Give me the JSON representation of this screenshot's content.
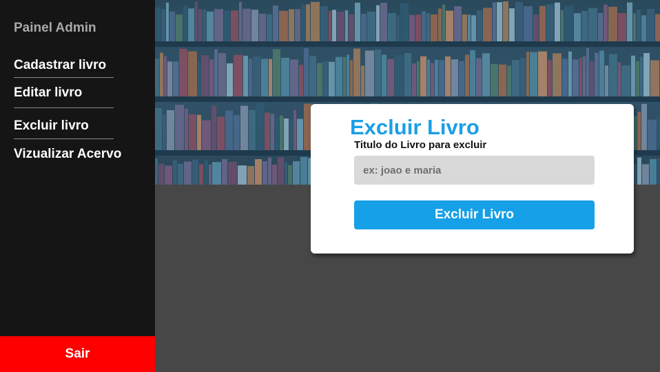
{
  "sidebar": {
    "brand": "Painel Admin",
    "items": [
      {
        "label": "Cadastrar livro"
      },
      {
        "label": "Editar livro"
      },
      {
        "label": "Excluir livro"
      },
      {
        "label": "Vizualizar Acervo"
      }
    ],
    "logout_label": "Sair"
  },
  "form": {
    "title": "Excluir Livro",
    "field_label": "Titulo do Livro para excluir",
    "input_value": "",
    "input_placeholder": "ex: joao e maria",
    "submit_label": "Excluir Livro"
  },
  "colors": {
    "sidebar_bg": "#151515",
    "logout_bg": "#ff0000",
    "accent": "#1a9fe6",
    "content_bg": "#474747"
  }
}
